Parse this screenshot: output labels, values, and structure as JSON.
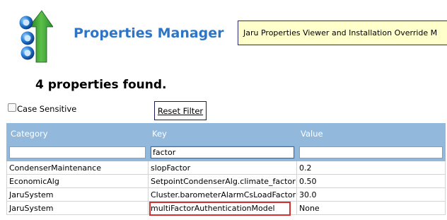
{
  "app": {
    "title": "Properties Manager",
    "banner_text": "Jaru Properties Viewer and Installation Override M",
    "logo_icon": "stacked-gears-up-arrow-icon"
  },
  "results": {
    "heading": "4 properties found."
  },
  "filter": {
    "case_sensitive_label": "Case Sensitive",
    "case_sensitive_checked": false,
    "reset_label": "Reset Filter"
  },
  "table": {
    "headers": [
      "Category",
      "Key",
      "Value"
    ],
    "filters": {
      "category": "",
      "key": "factor",
      "value": ""
    },
    "rows": [
      {
        "category": "CondenserMaintenance",
        "key": "slopFactor",
        "value": "0.2"
      },
      {
        "category": "EconomicAlg",
        "key": "SetpointCondenserAlg.climate_factor",
        "value": "0.50"
      },
      {
        "category": "JaruSystem",
        "key": "Cluster.barometerAlarmCsLoadFactor",
        "value": "30.0"
      },
      {
        "category": "JaruSystem",
        "key": "multiFactorAuthenticationModel",
        "value": "None"
      }
    ]
  },
  "colors": {
    "accent": "#2e75c7",
    "header_bg": "#92b9dc",
    "banner_bg": "#ffffcc",
    "highlight": "#d63131"
  }
}
